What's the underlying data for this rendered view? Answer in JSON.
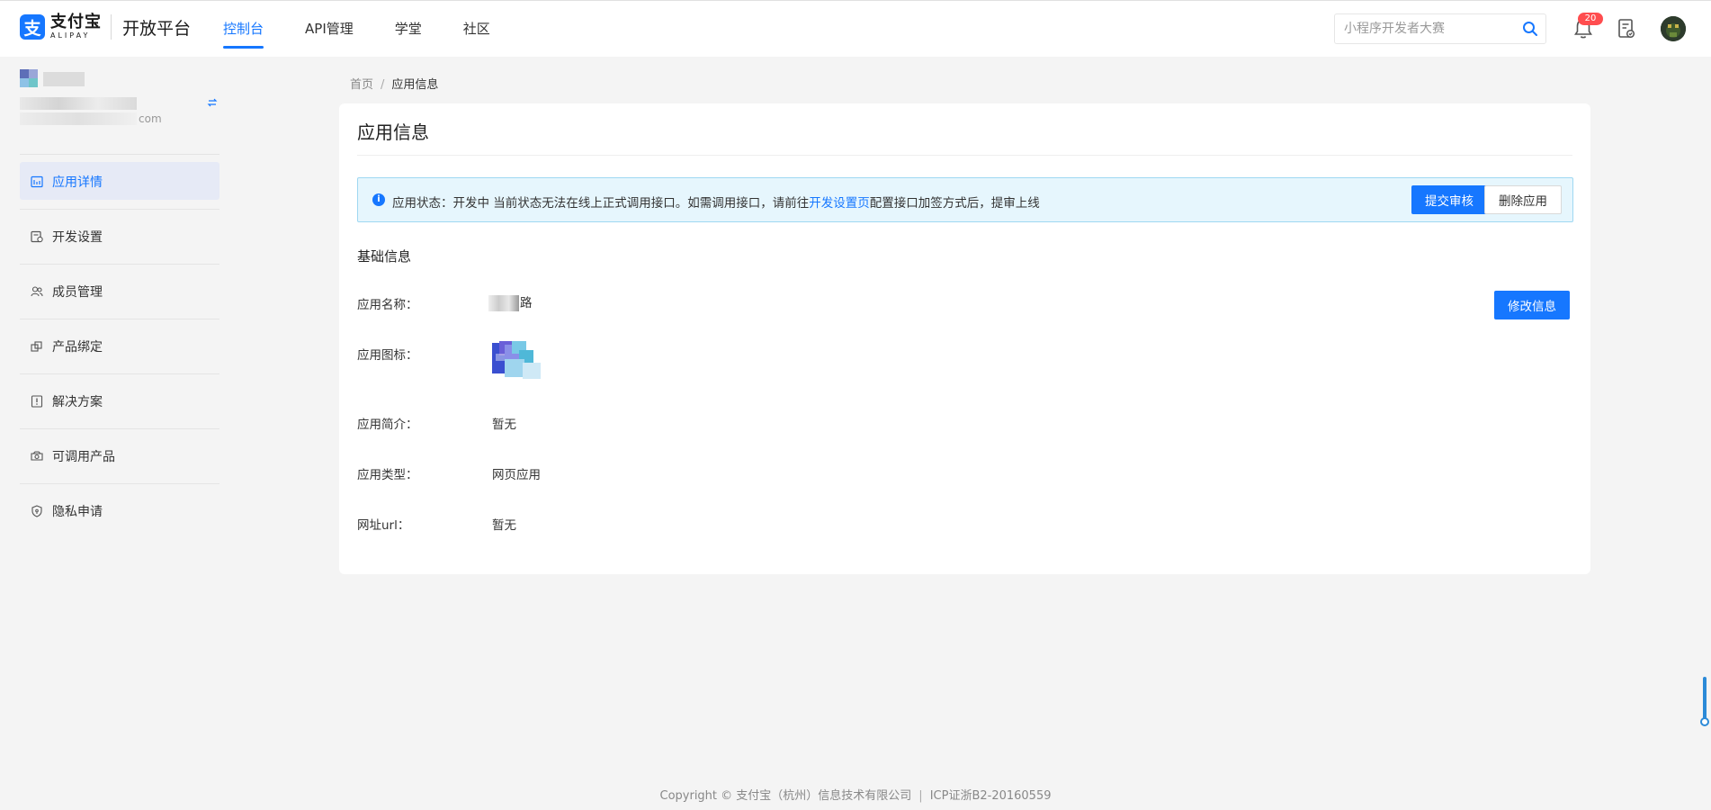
{
  "header": {
    "logo_cn": "支付宝",
    "logo_en": "ALIPAY",
    "platform": "开放平台",
    "nav": [
      {
        "label": "控制台",
        "active": true
      },
      {
        "label": "API管理",
        "active": false
      },
      {
        "label": "学堂",
        "active": false
      },
      {
        "label": "社区",
        "active": false
      }
    ],
    "search_placeholder": "小程序开发者大赛",
    "notification_count": "20"
  },
  "sidebar": {
    "account_email_suffix": "com",
    "items": [
      {
        "label": "应用详情",
        "icon": "app-detail-icon",
        "active": true
      },
      {
        "label": "开发设置",
        "icon": "dev-settings-icon",
        "active": false
      },
      {
        "label": "成员管理",
        "icon": "members-icon",
        "active": false
      },
      {
        "label": "产品绑定",
        "icon": "product-bind-icon",
        "active": false
      },
      {
        "label": "解决方案",
        "icon": "solution-icon",
        "active": false
      },
      {
        "label": "可调用产品",
        "icon": "callable-product-icon",
        "active": false
      },
      {
        "label": "隐私申请",
        "icon": "privacy-icon",
        "active": false
      }
    ]
  },
  "breadcrumb": {
    "home": "首页",
    "separator": "/",
    "current": "应用信息"
  },
  "main": {
    "title": "应用信息",
    "alert": {
      "prefix": "应用状态：开发中 当前状态无法在线上正式调用接口。如需调用接口，请前往",
      "link": "开发设置页",
      "suffix": "配置接口加签方式后，提审上线",
      "submit_label": "提交审核",
      "delete_label": "删除应用"
    },
    "section_title": "基础信息",
    "edit_label": "修改信息",
    "fields": {
      "name_label": "应用名称：",
      "name_value_visible": "路",
      "icon_label": "应用图标：",
      "desc_label": "应用简介：",
      "desc_value": "暂无",
      "type_label": "应用类型：",
      "type_value": "网页应用",
      "url_label": "网址url：",
      "url_value": "暂无"
    }
  },
  "footer": {
    "copyright": "Copyright © 支付宝（杭州）信息技术有限公司",
    "separator": "|",
    "icp": "ICP证浙B2-20160559"
  },
  "colors": {
    "accent": "#1677ff",
    "alert_bg": "#e6f6fd",
    "alert_border": "#9fd8f2",
    "badge": "#ff4d4f",
    "page_bg": "#f4f4f4"
  }
}
